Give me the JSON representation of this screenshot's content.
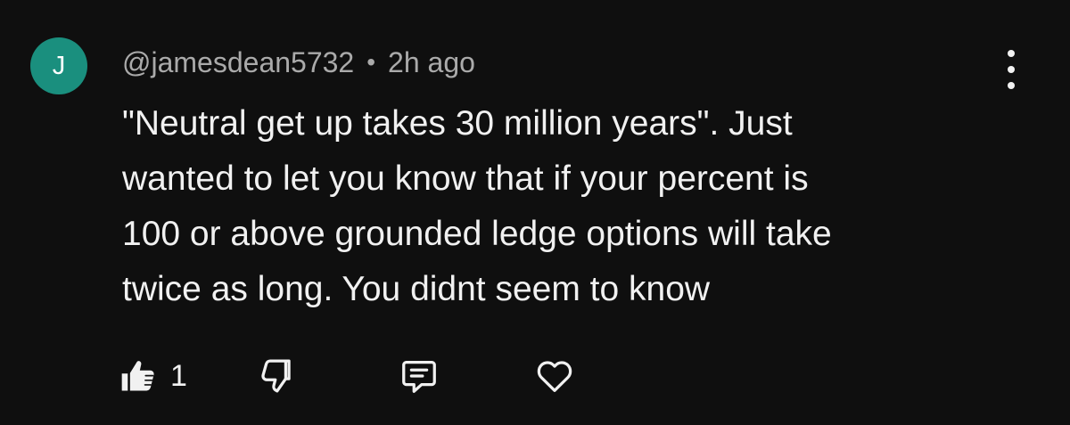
{
  "comment": {
    "avatar_letter": "J",
    "avatar_color": "#1a8f7e",
    "author": "@jamesdean5732",
    "separator": "•",
    "timestamp": "2h ago",
    "text_lines": [
      "\"Neutral get up takes 30 million years\". Just",
      "wanted to let you know that if your percent is",
      "100 or above grounded ledge options will take",
      "twice as long. You didnt seem to know"
    ],
    "like_count": "1"
  },
  "icons": {
    "menu": "more-vert-icon",
    "like": "thumbs-up-icon",
    "dislike": "thumbs-down-icon",
    "reply": "reply-comment-icon",
    "heart": "heart-icon"
  }
}
